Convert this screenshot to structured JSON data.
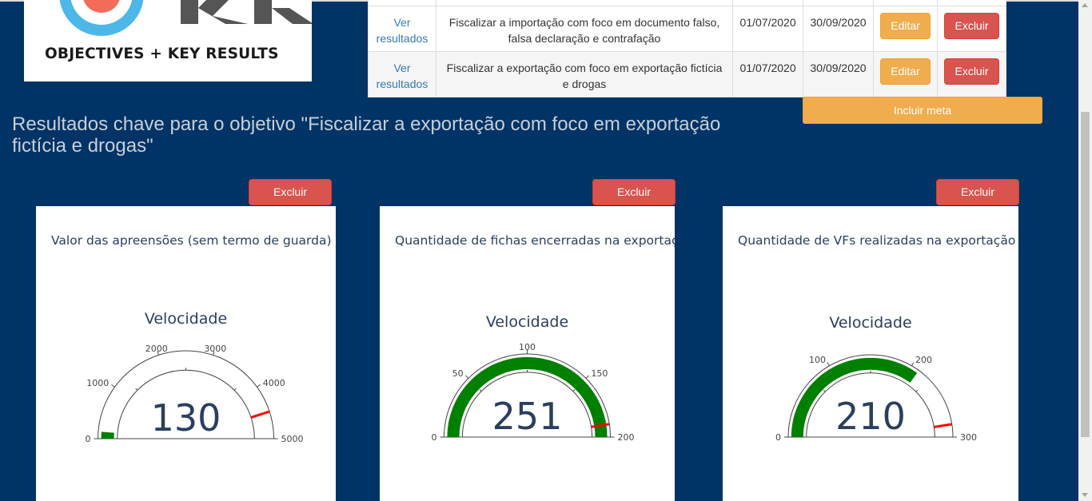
{
  "logo": {
    "tagline": "OBJECTIVES   +   KEY RESULTS",
    "colors": {
      "ring": "#4db8e8",
      "core": "#f26b5b",
      "letters": "#555555"
    }
  },
  "goals": {
    "rows": [
      {
        "link": "Ver resultados",
        "description": "Fiscalizar a importação com foco em documento falso, falsa declaração e contrafação",
        "start": "01/07/2020",
        "end": "30/09/2020",
        "edit": "Editar",
        "delete": "Excluir"
      },
      {
        "link": "Ver resultados",
        "description": "Fiscalizar a exportação com foco em exportação fictícia e drogas",
        "start": "01/07/2020",
        "end": "30/09/2020",
        "edit": "Editar",
        "delete": "Excluir"
      }
    ]
  },
  "include_goal_button": "Incluir meta",
  "heading": "Resultados chave para o objetivo \"Fiscalizar a exportação com foco em exportação fictícia e drogas\"",
  "cards": [
    {
      "delete": "Excluir",
      "title": "Valor das apreensões (sem termo de guarda)",
      "gauge_title": "Velocidade",
      "value": 130,
      "display": "130",
      "max": 5000,
      "threshold": 4500,
      "ticks": [
        0,
        1000,
        2000,
        3000,
        4000,
        5000
      ]
    },
    {
      "delete": "Excluir",
      "title": "Quantidade de fichas encerradas na exportação",
      "gauge_title": "Velocidade",
      "value": 251,
      "display": "251",
      "max": 200,
      "threshold": 190,
      "ticks": [
        0,
        50,
        100,
        150,
        200
      ]
    },
    {
      "delete": "Excluir",
      "title": "Quantidade de VFs realizadas na exportação",
      "gauge_title": "Velocidade",
      "value": 210,
      "display": "210",
      "max": 300,
      "threshold": 285,
      "ticks": [
        0,
        100,
        200,
        300
      ]
    }
  ],
  "colors": {
    "background": "#003366",
    "bar": "#008000",
    "threshold": "#ff0000",
    "warning": "#f0ad4e",
    "danger": "#d9534f",
    "link": "#337ab7"
  }
}
